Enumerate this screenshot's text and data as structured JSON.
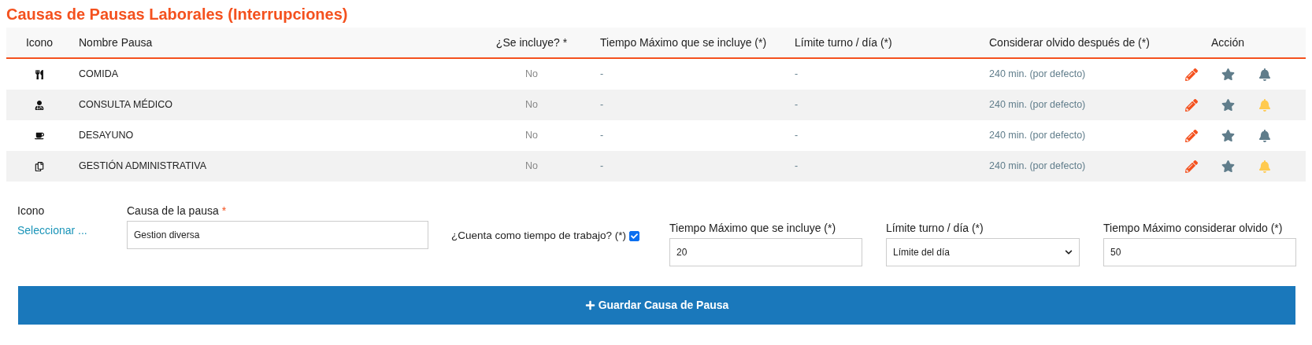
{
  "title": "Causas de Pausas Laborales (Interrupciones)",
  "table": {
    "columns": [
      "Icono",
      "Nombre Pausa",
      "¿Se incluye? *",
      "Tiempo Máximo que se incluye (*)",
      "Límite turno / día (*)",
      "Considerar olvido después de (*)",
      "Acción"
    ],
    "rows": [
      {
        "kind": "utensils",
        "name": "COMIDA",
        "included": "No",
        "max_time": "-",
        "limit": "-",
        "forget_after": "240 min. (por defecto)",
        "alert": false
      },
      {
        "kind": "doctor",
        "name": "CONSULTA MÉDICO",
        "included": "No",
        "max_time": "-",
        "limit": "-",
        "forget_after": "240 min. (por defecto)",
        "alert": true
      },
      {
        "kind": "coffee",
        "name": "DESAYUNO",
        "included": "No",
        "max_time": "-",
        "limit": "-",
        "forget_after": "240 min. (por defecto)",
        "alert": false
      },
      {
        "kind": "copy",
        "name": "GESTIÓN ADMINISTRATIVA",
        "included": "No",
        "max_time": "-",
        "limit": "-",
        "forget_after": "240 min. (por defecto)",
        "alert": true
      }
    ]
  },
  "form": {
    "icon_label": "Icono",
    "icon_link": "Seleccionar ...",
    "cause_label": "Causa de la pausa",
    "required_mark": "*",
    "cause_value": "Gestion diversa",
    "counts_label": "¿Cuenta como tiempo de trabajo? (*)",
    "counts_checked": true,
    "max_time_label": "Tiempo Máximo que se incluye (*)",
    "max_time_value": "20",
    "limit_label": "Límite turno / día (*)",
    "limit_value": "Límite del día",
    "forget_label": "Tiempo Máximo considerar olvido (*)",
    "forget_value": "50",
    "button": "Guardar Causa de Pausa"
  }
}
